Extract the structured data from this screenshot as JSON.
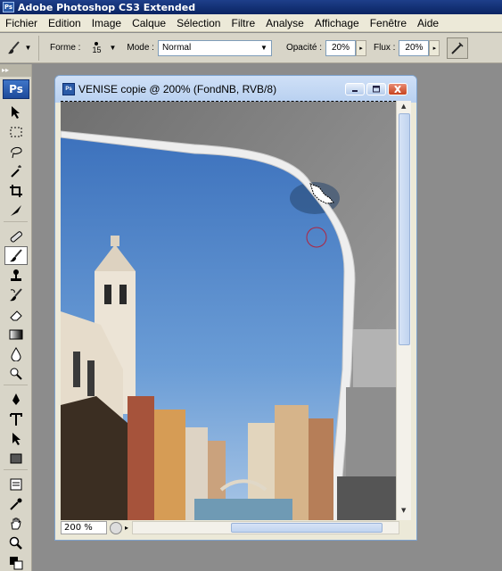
{
  "app": {
    "title": "Adobe Photoshop CS3 Extended",
    "logo_small": "Ps"
  },
  "menu": [
    "Fichier",
    "Edition",
    "Image",
    "Calque",
    "Sélection",
    "Filtre",
    "Analyse",
    "Affichage",
    "Fenêtre",
    "Aide"
  ],
  "options": {
    "forme_label": "Forme :",
    "brush_size": "15",
    "mode_label": "Mode :",
    "mode_value": "Normal",
    "opacite_label": "Opacité :",
    "opacite_value": "20%",
    "flux_label": "Flux :",
    "flux_value": "20%"
  },
  "toolbox": {
    "grip": "▸▸",
    "logo": "Ps"
  },
  "document": {
    "title": "VENISE copie @ 200% (FondNB, RVB/8)",
    "icon": "Ps",
    "zoom": "200 %"
  },
  "colors": {
    "sky": "#4a7fc4",
    "paper": "#e9e9e9",
    "titlebar": "#1e3f8a"
  }
}
